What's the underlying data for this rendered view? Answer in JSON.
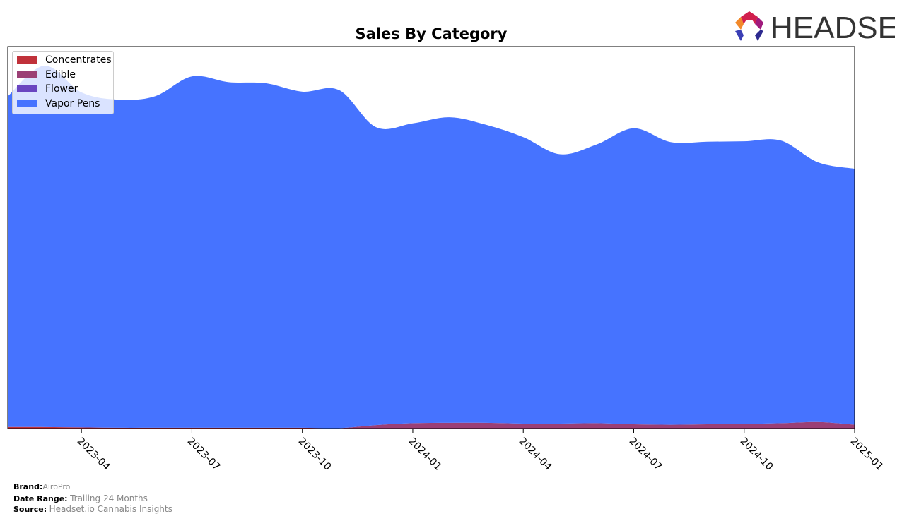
{
  "header": {
    "title": "Sales By Category",
    "logo_text": "HEADSET"
  },
  "chart_data": {
    "type": "area",
    "title": "Sales By Category",
    "xlabel": "",
    "ylabel": "",
    "stacked": true,
    "grid": false,
    "legend_position": "top-left",
    "x_ticks": [
      "2023-04",
      "2023-07",
      "2023-10",
      "2024-01",
      "2024-04",
      "2024-07",
      "2024-10",
      "2025-01"
    ],
    "x": [
      "2023-02",
      "2023-03",
      "2023-04",
      "2023-05",
      "2023-06",
      "2023-07",
      "2023-08",
      "2023-09",
      "2023-10",
      "2023-11",
      "2023-12",
      "2024-01",
      "2024-02",
      "2024-03",
      "2024-04",
      "2024-05",
      "2024-06",
      "2024-07",
      "2024-08",
      "2024-09",
      "2024-10",
      "2024-11",
      "2024-12",
      "2025-01"
    ],
    "ylim": [
      0,
      100
    ],
    "series": [
      {
        "name": "Concentrates",
        "color": "#c0313a",
        "values": [
          0.4,
          0.4,
          0.3,
          0.2,
          0.2,
          0.2,
          0.2,
          0.2,
          0.2,
          0.1,
          0.1,
          0.1,
          0.1,
          0.1,
          0.1,
          0.1,
          0.1,
          0.1,
          0.1,
          0.1,
          0.1,
          0.1,
          0.1,
          0.1
        ]
      },
      {
        "name": "Edible",
        "color": "#9b3f75",
        "values": [
          0,
          0,
          0,
          0,
          0,
          0,
          0,
          0,
          0,
          0,
          0.8,
          1.3,
          1.4,
          1.4,
          1.2,
          1.2,
          1.3,
          1.0,
          0.9,
          1.0,
          1.1,
          1.3,
          1.6,
          0.9
        ]
      },
      {
        "name": "Flower",
        "color": "#6a45c0",
        "values": [
          0,
          0,
          0,
          0,
          0,
          0,
          0,
          0,
          0,
          0,
          0,
          0,
          0,
          0,
          0,
          0,
          0,
          0,
          0,
          0,
          0,
          0,
          0,
          0
        ]
      },
      {
        "name": "Vapor Pens",
        "color": "#4673ff",
        "values": [
          86.6,
          94.6,
          87.7,
          85.9,
          86.8,
          92.0,
          90.5,
          90.2,
          88.0,
          88.5,
          78.0,
          78.5,
          80.0,
          78.0,
          75.0,
          70.5,
          73.0,
          77.5,
          74.0,
          74.0,
          74.0,
          74.0,
          68.0,
          67.0
        ]
      }
    ]
  },
  "footer": {
    "brand_label": "Brand:",
    "brand_value": "AiroPro",
    "date_label": "Date Range:",
    "date_value": "Trailing 24 Months",
    "source_label": "Source:",
    "source_value": "Headset.io Cannabis Insights"
  }
}
